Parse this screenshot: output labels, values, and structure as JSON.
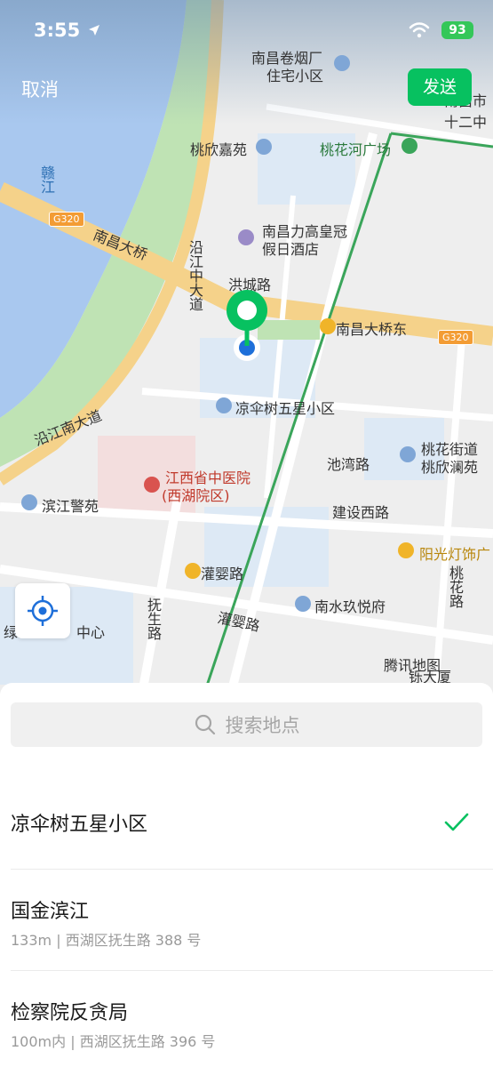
{
  "status_bar": {
    "time": "3:55",
    "battery": "93"
  },
  "header": {
    "cancel_label": "取消",
    "send_label": "发送"
  },
  "map": {
    "labels": {
      "nanchang_tobacco_1": "南昌卷烟厂",
      "nanchang_tobacco_2": "住宅小区",
      "taoxin_jiayuan": "桃欣嘉苑",
      "taohuahe_square": "桃花河广场",
      "gan_river": "赣江",
      "g320_left": "G320",
      "g320_right": "G320",
      "nanchang_bridge": "南昌大桥",
      "yanjiang_middle": "沿江中大道",
      "hotel_1": "南昌力高皇冠",
      "hotel_2": "假日酒店",
      "hongcheng_road": "洪城路",
      "bridge_east_station": "南昌大桥东",
      "liangsanshu": "凉伞树五星小区",
      "yanjiang_south": "沿江南大道",
      "chiwan_road": "池湾路",
      "taohua_street_1": "桃花街道",
      "taohua_street_2": "桃欣澜苑",
      "hospital_1": "江西省中医院",
      "hospital_2": "(西湖院区)",
      "binjiang_jingyuan": "滨江警苑",
      "jianshe_west": "建设西路",
      "sunshine_lights": "阳光灯饰广",
      "guanying_station": "灌婴路",
      "guanying_road": "灌婴路",
      "fusheng_road": "抚生路",
      "nanshui_yuefu": "南水玖悦府",
      "taohua_road": "桃花路",
      "center_partial": "中心",
      "edge_partial": "绿",
      "twelve_partial": "南昌市十二中",
      "building_partial": "铄大厦"
    },
    "brand": "腾讯地图",
    "colors": {
      "water": "#a9c8ef",
      "green": "#bfe3b4",
      "road": "#f5d28a",
      "pin": "#07c160",
      "dot": "#1e6fd9"
    }
  },
  "locate_button": {
    "icon": "crosshair-icon"
  },
  "sheet": {
    "search_placeholder": "搜索地点",
    "results": [
      {
        "name": "凉伞树五星小区",
        "sub": "",
        "selected": true
      },
      {
        "name": "国金滨江",
        "sub": "133m | 西湖区抚生路 388 号",
        "selected": false
      },
      {
        "name": "检察院反贪局",
        "sub": "100m内 | 西湖区抚生路 396 号",
        "selected": false
      }
    ]
  }
}
